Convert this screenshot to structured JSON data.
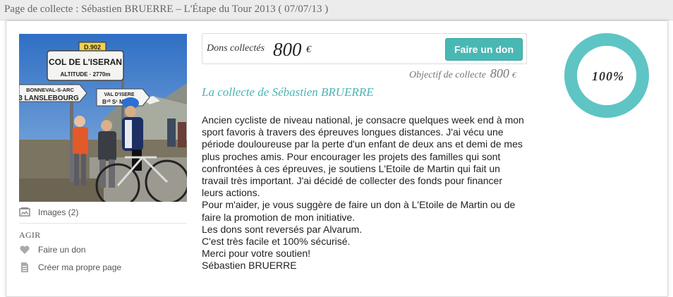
{
  "header": {
    "title": "Page de collecte : Sébastien BRUERRE – L'Étape du Tour 2013 ( 07/07/13 )"
  },
  "photo": {
    "signs": {
      "col": "COL DE L'ISERAN",
      "altitude": "ALTITUDE · 2770m",
      "road": "D.902",
      "left1": "BONNEVAL-S-ARC",
      "left2": "3 LANSLEBOURG",
      "right1": "VAL D'ISERE",
      "right2": "B¹⁰ S¹ MAUR"
    }
  },
  "sidebar": {
    "images_label": "Images (2)",
    "agir_label": "AGIR",
    "faire_un_don_label": "Faire un don",
    "creer_page_label": "Créer ma propre page"
  },
  "donation": {
    "label": "Dons collectés",
    "amount": "800",
    "currency": "€",
    "button_label": "Faire un don",
    "objectif_label": "Objectif de collecte",
    "objectif_amount": "800",
    "objectif_currency": "€"
  },
  "progress": {
    "percent_label": "100%",
    "value": 1.0
  },
  "collecte": {
    "title": "La collecte de Sébastien BRUERRE",
    "paragraphs": [
      "Ancien cycliste de niveau national, je consacre quelques week end à mon sport favoris à travers des épreuves longues distances. J'ai vécu une période douloureuse par la perte d'un enfant de deux ans et demi de mes plus proches amis. Pour encourager les projets des familles qui sont confrontées à ces épreuves, je soutiens L'Etoile de Martin qui fait un travail très important. J'ai décidé de collecter des fonds pour financer leurs actions.",
      "Pour m'aider, je vous suggère de faire un don à L'Etoile de Martin ou de faire la promotion de mon initiative.",
      "Les dons sont reversés par Alvarum.",
      "C'est très facile et 100% sécurisé.",
      "Merci pour votre soutien!",
      "Sébastien BRUERRE"
    ]
  },
  "colors": {
    "accent": "#49b8b4",
    "title_teal": "#4ab3b4",
    "gauge_ring": "#5fc4c4"
  }
}
